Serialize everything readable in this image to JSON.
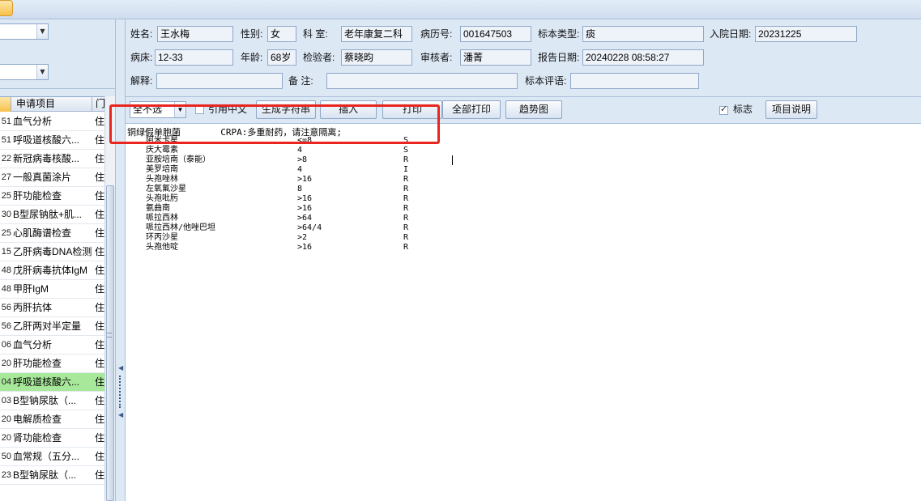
{
  "left": {
    "grid_headers": {
      "item": "申请项目",
      "type": "门"
    },
    "rows": [
      {
        "id": "51",
        "item": "血气分析",
        "type": "住"
      },
      {
        "id": "51",
        "item": "呼吸道核酸六...",
        "type": "住"
      },
      {
        "id": "22",
        "item": "新冠病毒核酸...",
        "type": "住"
      },
      {
        "id": "27",
        "item": "一般真菌涂片",
        "type": "住"
      },
      {
        "id": "25",
        "item": "肝功能检查",
        "type": "住"
      },
      {
        "id": "30",
        "item": "B型尿钠肽+肌...",
        "type": "住"
      },
      {
        "id": "25",
        "item": "心肌酶谱检查",
        "type": "住"
      },
      {
        "id": "15",
        "item": "乙肝病毒DNA检测",
        "type": "住"
      },
      {
        "id": "48",
        "item": "戊肝病毒抗体IgM",
        "type": "住"
      },
      {
        "id": "48",
        "item": "甲肝IgM",
        "type": "住"
      },
      {
        "id": "56",
        "item": "丙肝抗体",
        "type": "住"
      },
      {
        "id": "56",
        "item": "乙肝两对半定量",
        "type": "住"
      },
      {
        "id": "06",
        "item": "血气分析",
        "type": "住"
      },
      {
        "id": "20",
        "item": "肝功能检查",
        "type": "住"
      },
      {
        "id": "04",
        "item": "呼吸道核酸六...",
        "type": "住",
        "selected": true
      },
      {
        "id": "03",
        "item": "B型钠尿肽（...",
        "type": "住"
      },
      {
        "id": "20",
        "item": "电解质检查",
        "type": "住"
      },
      {
        "id": "20",
        "item": "肾功能检查",
        "type": "住"
      },
      {
        "id": "50",
        "item": "血常规（五分...",
        "type": "住"
      },
      {
        "id": "23",
        "item": "B型钠尿肽（...",
        "type": "住"
      }
    ]
  },
  "patient": {
    "name_label": "姓名:",
    "name": "王水梅",
    "gender_label": "性别:",
    "gender": "女",
    "dept_label": "科  室:",
    "dept": "老年康复二科",
    "record_label": "病历号:",
    "record_no": "001647503",
    "specimen_label": "标本类型:",
    "specimen": "痰",
    "admit_label": "入院日期:",
    "admit_date": "20231225",
    "bed_label": "病床:",
    "bed": "12-33",
    "age_label": "年龄:",
    "age": "68岁",
    "inspector_label": "检验者:",
    "inspector": "蔡晓昀",
    "reviewer_label": "审核者:",
    "reviewer": "潘菁",
    "report_label": "报告日期:",
    "report_date": "20240228 08:58:27",
    "explain_label": "解释:",
    "explain": "",
    "remark_label": "备  注:",
    "remark": "",
    "comment_label": "标本评语:",
    "comment": ""
  },
  "toolbar": {
    "select_value": "全不选",
    "cite_chinese_label": "引用中文",
    "generate_label": "生成字符串",
    "insert_label": "插入",
    "print_label": "打印",
    "print_all_label": "全部打印",
    "trend_label": "趋势图",
    "mark_label": "标志",
    "mark_checked": true,
    "item_desc_label": "项目说明"
  },
  "result": {
    "organism": "铜绿假单胞菌",
    "note": "CRPA:多重耐药，请注意隔离;",
    "antibiotics": [
      {
        "name": "阿米卡星",
        "mic": "<=8",
        "interp": "S"
      },
      {
        "name": "庆大霉素",
        "mic": "4",
        "interp": "S"
      },
      {
        "name": "亚胺培南（泰能）",
        "mic": ">8",
        "interp": "R"
      },
      {
        "name": "美罗培南",
        "mic": "4",
        "interp": "I"
      },
      {
        "name": "头孢唑林",
        "mic": ">16",
        "interp": "R"
      },
      {
        "name": "左氧氟沙星",
        "mic": "8",
        "interp": "R"
      },
      {
        "name": "头孢吡肟",
        "mic": ">16",
        "interp": "R"
      },
      {
        "name": "氨曲南",
        "mic": ">16",
        "interp": "R"
      },
      {
        "name": "哌拉西林",
        "mic": ">64",
        "interp": "R"
      },
      {
        "name": "哌拉西林/他唑巴坦",
        "mic": ">64/4",
        "interp": "R"
      },
      {
        "name": "环丙沙星",
        "mic": ">2",
        "interp": "R"
      },
      {
        "name": "头孢他啶",
        "mic": ">16",
        "interp": "R"
      }
    ]
  },
  "colors": {
    "highlight": "#e8251f",
    "selected_row": "#a8e89a",
    "panel": "#dde8f5"
  }
}
